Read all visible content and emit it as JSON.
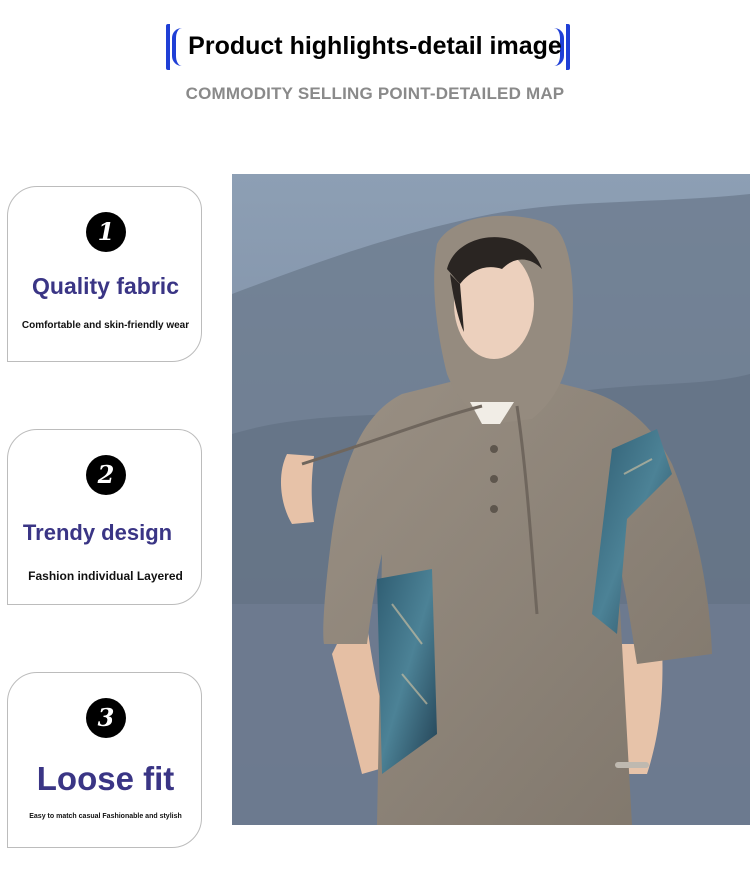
{
  "header": {
    "title": "Product highlights-detail image",
    "subtitle": "COMMODITY SELLING POINT-DETAILED MAP"
  },
  "features": [
    {
      "number": "1",
      "title": "Quality fabric",
      "desc": "Comfortable and skin-friendly wear"
    },
    {
      "number": "2",
      "title": "Trendy design",
      "desc": "Fashion individual Layered"
    },
    {
      "number": "3",
      "title": "Loose fit",
      "desc": "Easy to match casual Fashionable and stylish"
    }
  ],
  "colors": {
    "accent": "#1f3fd6",
    "feature_title": "#3a3585",
    "subtitle_gray": "#8a8a8a",
    "garment": "#8d8377"
  }
}
